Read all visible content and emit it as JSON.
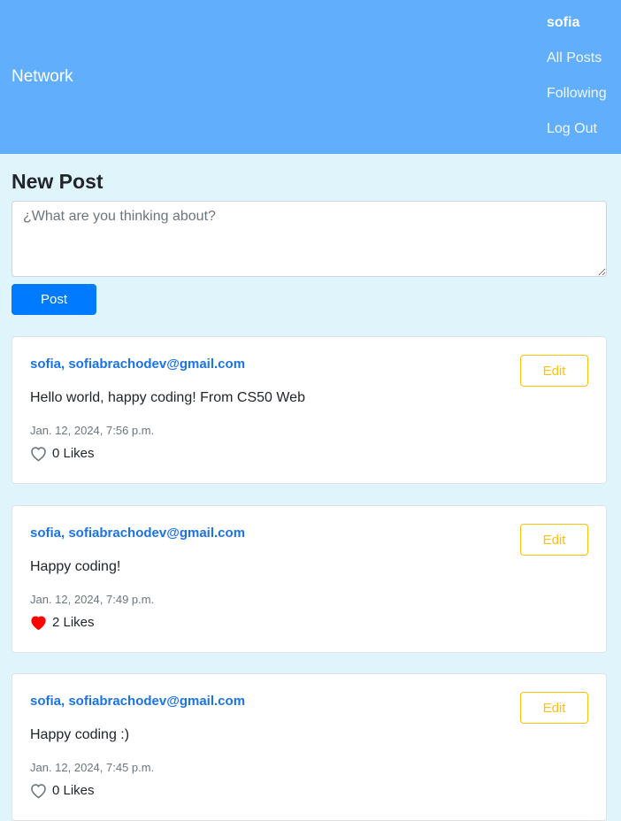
{
  "navbar": {
    "brand": "Network",
    "user": "sofia",
    "links": [
      "All Posts",
      "Following",
      "Log Out"
    ]
  },
  "new_post": {
    "title": "New Post",
    "placeholder": "¿What are you thinking about?",
    "value": "",
    "button_label": "Post"
  },
  "posts": [
    {
      "author": "sofia, sofiabrachodev@gmail.com",
      "content": "Hello world, happy coding! From CS50 Web",
      "date": "Jan. 12, 2024, 7:56 p.m.",
      "likes": "0 Likes",
      "liked": false,
      "edit_label": "Edit"
    },
    {
      "author": "sofia, sofiabrachodev@gmail.com",
      "content": "Happy coding!",
      "date": "Jan. 12, 2024, 7:49 p.m.",
      "likes": "2 Likes",
      "liked": true,
      "edit_label": "Edit"
    },
    {
      "author": "sofia, sofiabrachodev@gmail.com",
      "content": "Happy coding :)",
      "date": "Jan. 12, 2024, 7:45 p.m.",
      "likes": "0 Likes",
      "liked": false,
      "edit_label": "Edit"
    }
  ],
  "colors": {
    "navbar_bg": "#61aefc",
    "page_bg": "#e0f4fb",
    "primary": "#007bff",
    "link": "#1a73e8",
    "warning": "#ffc107",
    "like_active": "#ff0000",
    "like_inactive": "#6c757d"
  },
  "icons": {
    "like_empty": "heart-outline-icon",
    "like_filled": "heart-filled-icon"
  }
}
